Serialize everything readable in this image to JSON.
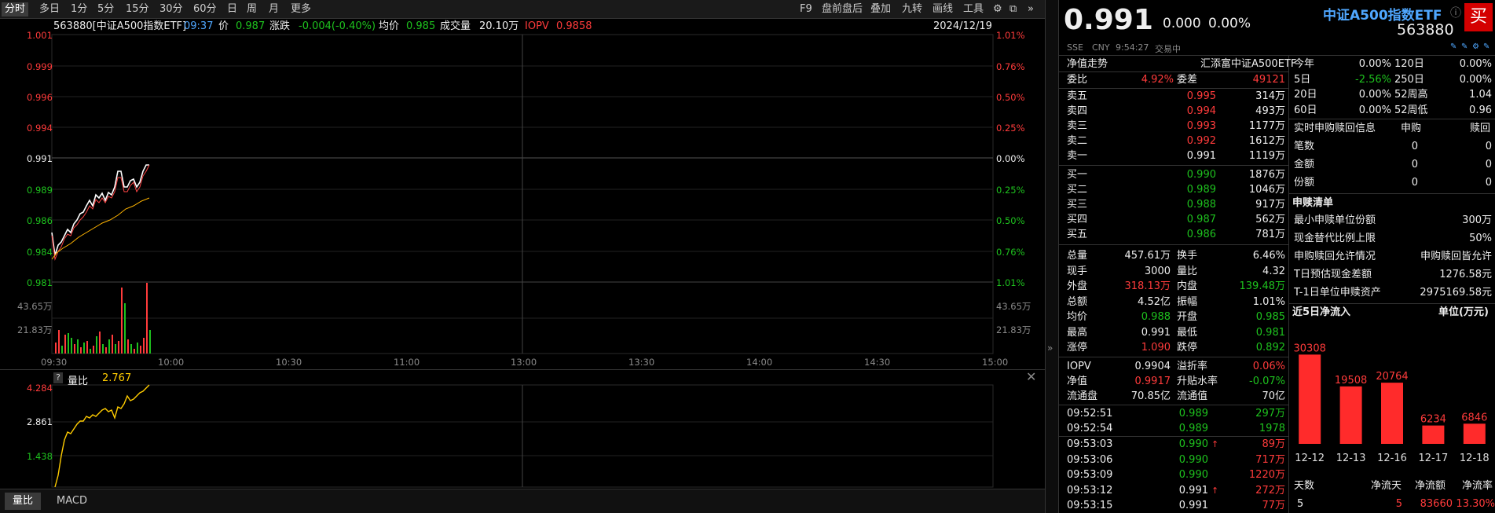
{
  "toolbar": {
    "periods": [
      "分时",
      "多日",
      "1分",
      "5分",
      "15分",
      "30分",
      "60分",
      "日",
      "周",
      "月",
      "更多"
    ],
    "right_items": [
      "F9",
      "盘前盘后",
      "叠加",
      "九转",
      "画线",
      "工具"
    ]
  },
  "info": {
    "name": "563880[中证A500指数ETF]",
    "time": "09:37",
    "price_label": "价",
    "price": "0.987",
    "change_label": "涨跌",
    "change": "-0.004(-0.40%)",
    "avg_label": "均价",
    "avg": "0.985",
    "volume_label": "成交量",
    "volume": "20.10万",
    "iopv_label": "IOPV",
    "iopv": "0.9858",
    "date": "2024/12/19"
  },
  "price_axis": {
    "left": [
      "1.001",
      "0.999",
      "0.996",
      "0.994",
      "0.991",
      "0.989",
      "0.986",
      "0.984",
      "0.981"
    ],
    "right": [
      "1.01%",
      "0.76%",
      "0.50%",
      "0.25%",
      "0.00%",
      "0.25%",
      "0.50%",
      "0.76%",
      "1.01%"
    ],
    "vol_left": [
      "43.65万",
      "21.83万"
    ],
    "vol_right": [
      "43.65万",
      "21.83万"
    ],
    "time": [
      "09:30",
      "10:00",
      "10:30",
      "11:00",
      "13:00",
      "13:30",
      "14:00",
      "14:30",
      "15:00"
    ]
  },
  "sub_chart": {
    "icon": "?",
    "label": "量比",
    "value": "2.767",
    "ticks": [
      "4.284",
      "2.861",
      "1.438"
    ],
    "tabs": [
      "量比",
      "MACD"
    ]
  },
  "quote": {
    "price": "0.991",
    "change": "0.000",
    "change_pct": "0.00%",
    "name": "中证A500指数ETF",
    "code": "563880",
    "buy_button": "买",
    "market": "SSE",
    "currency": "CNY",
    "time": "9:54:27",
    "status": "交易中",
    "nav_label": "净值走势",
    "fund_name": "汇添富中证A500ETF"
  },
  "orderbook": {
    "ratio_label": "委比",
    "ratio": "4.92%",
    "diff_label": "委差",
    "diff": "49121",
    "asks": [
      {
        "label": "卖五",
        "price": "0.995",
        "vol": "314万"
      },
      {
        "label": "卖四",
        "price": "0.994",
        "vol": "493万"
      },
      {
        "label": "卖三",
        "price": "0.993",
        "vol": "1177万"
      },
      {
        "label": "卖二",
        "price": "0.992",
        "vol": "1612万"
      },
      {
        "label": "卖一",
        "price": "0.991",
        "vol": "1119万"
      }
    ],
    "bids": [
      {
        "label": "买一",
        "price": "0.990",
        "vol": "1876万"
      },
      {
        "label": "买二",
        "price": "0.989",
        "vol": "1046万"
      },
      {
        "label": "买三",
        "price": "0.988",
        "vol": "917万"
      },
      {
        "label": "买四",
        "price": "0.987",
        "vol": "562万"
      },
      {
        "label": "买五",
        "price": "0.986",
        "vol": "781万"
      }
    ]
  },
  "stats": [
    {
      "l1": "总量",
      "v1": "457.61万",
      "l2": "换手",
      "v2": "6.46%"
    },
    {
      "l1": "现手",
      "v1": "3000",
      "l2": "量比",
      "v2": "4.32"
    },
    {
      "l1": "外盘",
      "v1": "318.13万",
      "l2": "内盘",
      "v2": "139.48万"
    },
    {
      "l1": "总额",
      "v1": "4.52亿",
      "l2": "振幅",
      "v2": "1.01%"
    },
    {
      "l1": "均价",
      "v1": "0.988",
      "l2": "开盘",
      "v2": "0.985"
    },
    {
      "l1": "最高",
      "v1": "0.991",
      "l2": "最低",
      "v2": "0.981"
    },
    {
      "l1": "涨停",
      "v1": "1.090",
      "l2": "跌停",
      "v2": "0.892"
    }
  ],
  "stats2": [
    {
      "l1": "IOPV",
      "v1": "0.9904",
      "l2": "溢折率",
      "v2": "0.06%"
    },
    {
      "l1": "净值",
      "v1": "0.9917",
      "l2": "升贴水率",
      "v2": "-0.07%"
    },
    {
      "l1": "流通盘",
      "v1": "70.85亿",
      "l2": "流通值",
      "v2": "70亿"
    }
  ],
  "ticks": [
    {
      "time": "09:52:51",
      "price": "0.989",
      "arrow": "",
      "vol": "297万"
    },
    {
      "time": "09:52:54",
      "price": "0.989",
      "arrow": "",
      "vol": "1978"
    },
    {
      "time": "09:53:03",
      "price": "0.990",
      "arrow": "↑",
      "vol": "89万"
    },
    {
      "time": "09:53:06",
      "price": "0.990",
      "arrow": "",
      "vol": "717万"
    },
    {
      "time": "09:53:09",
      "price": "0.990",
      "arrow": "",
      "vol": "1220万"
    },
    {
      "time": "09:53:12",
      "price": "0.991",
      "arrow": "↑",
      "vol": "272万"
    },
    {
      "time": "09:53:15",
      "price": "0.991",
      "arrow": "",
      "vol": "77万"
    }
  ],
  "returns": [
    {
      "l1": "今年",
      "v1": "0.00%",
      "l2": "120日",
      "v2": "0.00%"
    },
    {
      "l1": "5日",
      "v1": "-2.56%",
      "l2": "250日",
      "v2": "0.00%"
    },
    {
      "l1": "20日",
      "v1": "0.00%",
      "l2": "52周高",
      "v2": "1.04"
    },
    {
      "l1": "60日",
      "v1": "0.00%",
      "l2": "52周低",
      "v2": "0.96"
    }
  ],
  "realtime": {
    "title": "实时申购赎回信息",
    "col1": "申购",
    "col2": "赎回",
    "rows": [
      {
        "label": "笔数",
        "a": "0",
        "b": "0"
      },
      {
        "label": "金额",
        "a": "0",
        "b": "0"
      },
      {
        "label": "份额",
        "a": "0",
        "b": "0"
      }
    ]
  },
  "creation": {
    "title": "申赎清单",
    "rows": [
      {
        "label": "最小申赎单位份额",
        "value": "300万"
      },
      {
        "label": "现金替代比例上限",
        "value": "50%"
      },
      {
        "label": "申购赎回允许情况",
        "value": "申购赎回皆允许"
      },
      {
        "label": "T日预估现金差额",
        "value": "1276.58元"
      },
      {
        "label": "T-1日单位申赎资产",
        "value": "2975169.58元"
      }
    ]
  },
  "chart_data": {
    "type": "bar",
    "title": "近5日净流入",
    "unit": "单位(万元)",
    "categories": [
      "12-12",
      "12-13",
      "12-16",
      "12-17",
      "12-18"
    ],
    "values": [
      30308,
      19508,
      20764,
      6234,
      6846
    ]
  },
  "flow_table": {
    "headers": [
      "天数",
      "净流天",
      "净流额",
      "净流率"
    ],
    "row": [
      "5",
      "5",
      "83660",
      "13.30%"
    ]
  },
  "colors": {
    "up": "#ff3b3b",
    "down": "#1ec21e",
    "bar": "#ff2b2b",
    "accent": "#4fa7ff"
  }
}
